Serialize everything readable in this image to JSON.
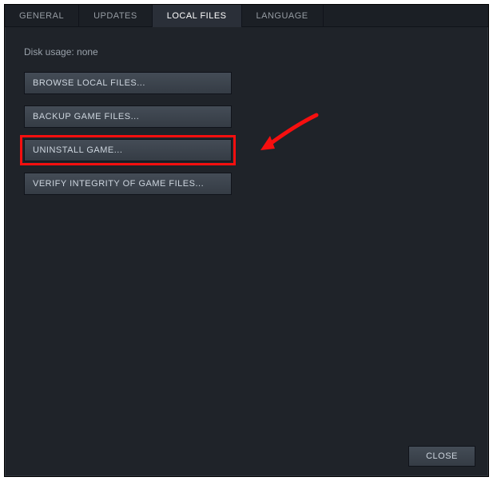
{
  "tabs": [
    {
      "label": "GENERAL",
      "id": "general"
    },
    {
      "label": "UPDATES",
      "id": "updates"
    },
    {
      "label": "LOCAL FILES",
      "id": "local-files"
    },
    {
      "label": "LANGUAGE",
      "id": "language"
    }
  ],
  "active_tab": "local-files",
  "disk_usage_label": "Disk usage: none",
  "actions": {
    "browse": "BROWSE LOCAL FILES...",
    "backup": "BACKUP GAME FILES...",
    "uninstall": "UNINSTALL GAME...",
    "verify": "VERIFY INTEGRITY OF GAME FILES..."
  },
  "highlighted_action": "uninstall",
  "annotation": {
    "highlight_color": "#f70f0f",
    "arrow_color": "#f70f0f"
  },
  "footer": {
    "close_label": "CLOSE"
  }
}
